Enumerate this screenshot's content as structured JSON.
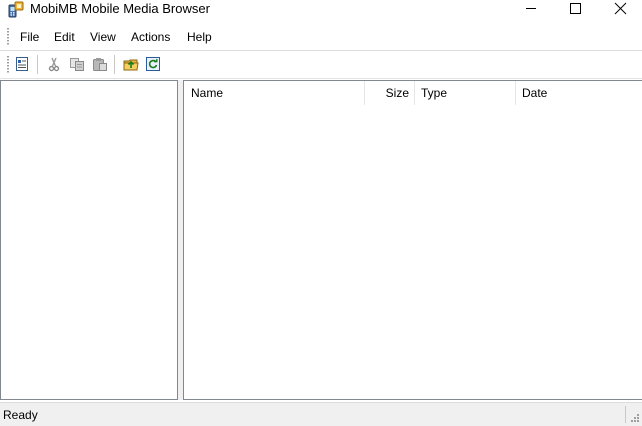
{
  "window": {
    "title": "MobiMB Mobile Media Browser",
    "app_icon": "mobile-phone-icon",
    "controls": [
      "minimize-icon",
      "maximize-icon",
      "close-icon"
    ]
  },
  "menu": {
    "items": [
      {
        "label": "File"
      },
      {
        "label": "Edit"
      },
      {
        "label": "View"
      },
      {
        "label": "Actions"
      },
      {
        "label": "Help"
      }
    ]
  },
  "toolbar": {
    "buttons": [
      {
        "icon": "properties-icon",
        "enabled": true
      },
      {
        "icon": "cut-icon",
        "enabled": false
      },
      {
        "icon": "copy-icon",
        "enabled": false
      },
      {
        "icon": "paste-icon",
        "enabled": false
      },
      {
        "icon": "upload-folder-icon",
        "enabled": true
      },
      {
        "icon": "refresh-icon",
        "enabled": true
      }
    ]
  },
  "file_list": {
    "columns": [
      {
        "label": "Name"
      },
      {
        "label": "Size"
      },
      {
        "label": "Type"
      },
      {
        "label": "Date"
      }
    ],
    "rows": []
  },
  "statusbar": {
    "text": "Ready"
  },
  "colors": {
    "pane_border": "#828790",
    "chrome_background": "#f0f0f0",
    "content_background": "#ffffff"
  }
}
